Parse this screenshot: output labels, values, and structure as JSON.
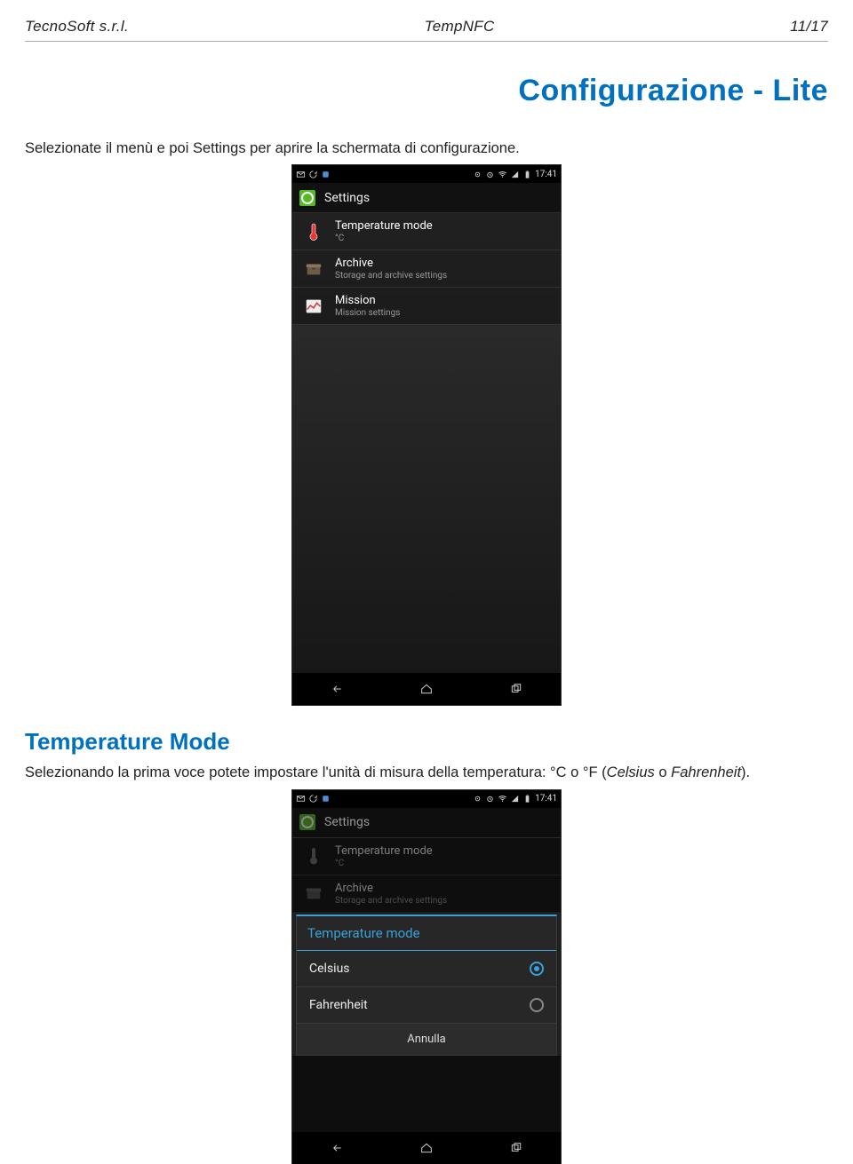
{
  "header": {
    "company": "TecnoSoft s.r.l.",
    "product": "TempNFC",
    "page": "11/17"
  },
  "page_title": "Configurazione - Lite",
  "intro_text": "Selezionate il menù e poi Settings per aprire la schermata di configurazione.",
  "section_title": "Temperature Mode",
  "section_text_pre": "Selezionando la prima voce potete impostare l'unità di misura della temperatura: °C o °F (",
  "section_text_ital": "Celsius",
  "section_text_mid": " o ",
  "section_text_ital2": "Fahrenheit",
  "section_text_post": ").",
  "statusbar": {
    "time": "17:41"
  },
  "appbar": {
    "title": "Settings"
  },
  "settings_items": [
    {
      "title": "Temperature mode",
      "sub": "°C"
    },
    {
      "title": "Archive",
      "sub": "Storage and archive settings"
    },
    {
      "title": "Mission",
      "sub": "Mission settings"
    }
  ],
  "dialog": {
    "title": "Temperature mode",
    "options": [
      {
        "label": "Celsius",
        "selected": true
      },
      {
        "label": "Fahrenheit",
        "selected": false
      }
    ],
    "cancel": "Annulla"
  }
}
